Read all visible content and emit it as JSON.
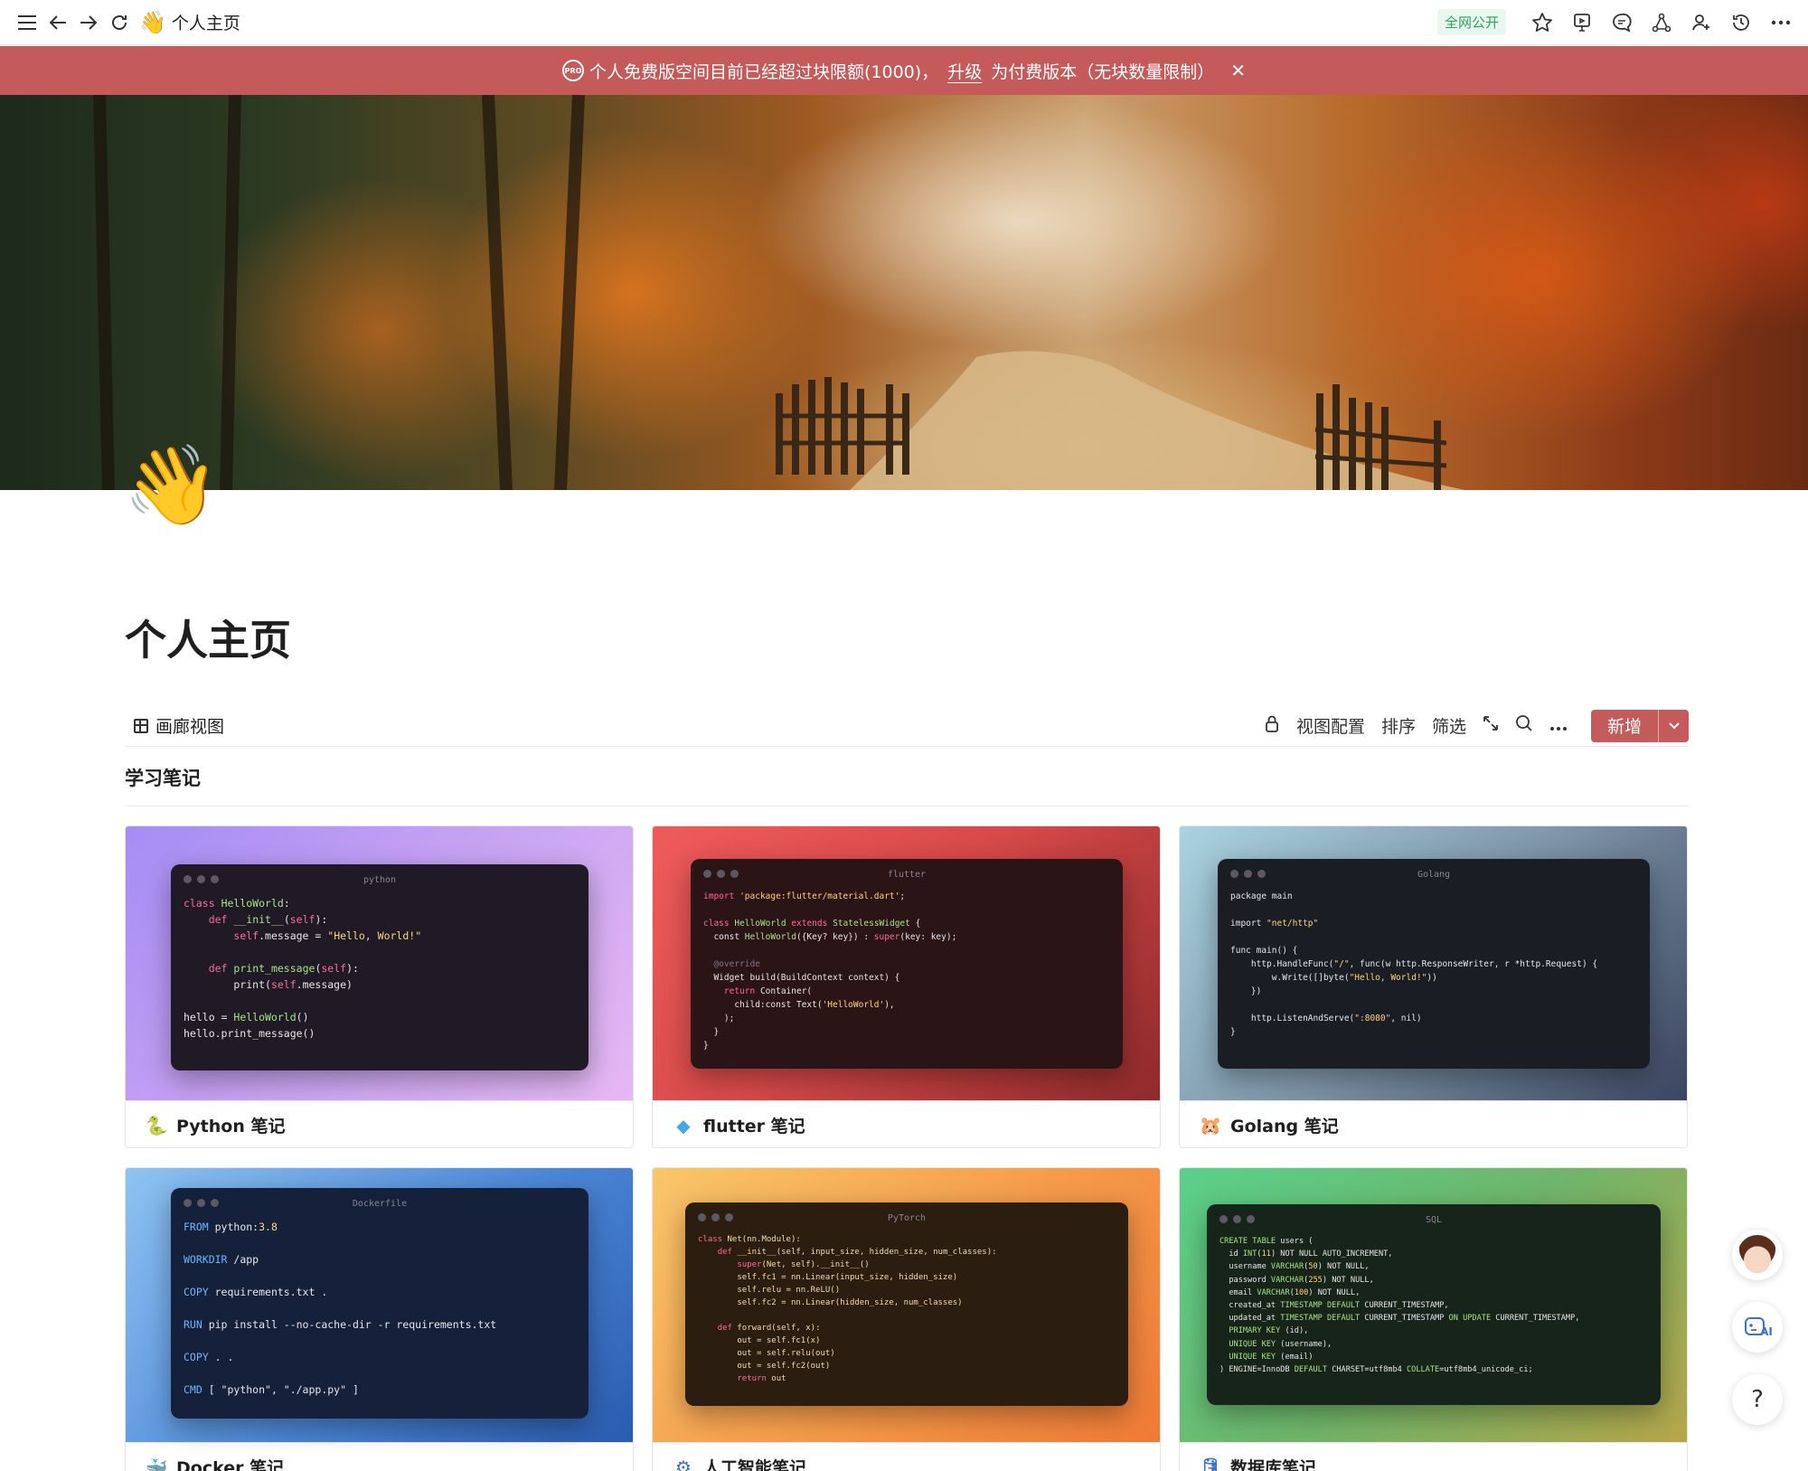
{
  "topbar": {
    "page_emoji": "👋",
    "page_title": "个人主页",
    "public_badge": "全网公开"
  },
  "banner": {
    "pro_label": "PRO",
    "text_before": "个人免费版空间目前已经超过块限额(1000)，",
    "upgrade_link": "升级",
    "text_after": "为付费版本（无块数量限制）",
    "close": "✕"
  },
  "page": {
    "icon_emoji": "👋",
    "title": "个人主页"
  },
  "viewbar": {
    "view_name": "画廊视图",
    "view_config": "视图配置",
    "sort": "排序",
    "filter": "筛选",
    "new_button": "新增"
  },
  "group": {
    "title": "学习笔记"
  },
  "cards": [
    {
      "label": "Python 笔记",
      "icon": "🐍",
      "window_title": "python"
    },
    {
      "label": "flutter 笔记",
      "icon": "◆",
      "window_title": "flutter"
    },
    {
      "label": "Golang 笔记",
      "icon": "🐹",
      "window_title": "Golang"
    },
    {
      "label": "Docker 笔记",
      "icon": "🐳",
      "window_title": "Dockerfile"
    },
    {
      "label": "人工智能笔记",
      "icon": "⚙",
      "window_title": "PyTorch"
    },
    {
      "label": "数据库笔记",
      "icon": "🛢",
      "window_title": "SQL"
    }
  ],
  "floating": {
    "help": "?",
    "ai_label": "AI"
  },
  "colors": {
    "brand_red": "#c45a59",
    "public_green": "#2ea35f"
  }
}
